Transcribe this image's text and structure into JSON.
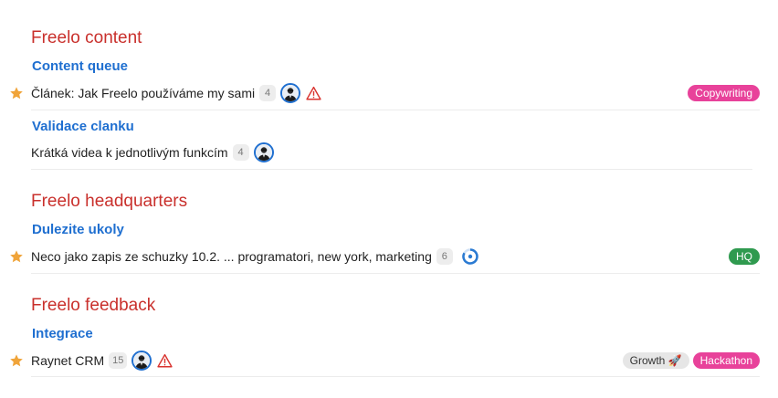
{
  "projects": [
    {
      "title": "Freelo content",
      "lists": [
        {
          "title": "Content queue",
          "tasks": [
            {
              "name": "Článek: Jak Freelo používáme my sami",
              "count": "4",
              "starred": true,
              "warning": true,
              "tags": [
                {
                  "label": "Copywriting",
                  "color": "#e8429a"
                }
              ]
            }
          ]
        },
        {
          "title": "Validace clanku",
          "tasks": [
            {
              "name": "Krátká videa k jednotlivým funkcím",
              "count": "4",
              "starred": false,
              "warning": false,
              "tags": []
            }
          ]
        }
      ]
    },
    {
      "title": "Freelo headquarters",
      "lists": [
        {
          "title": "Dulezite ukoly",
          "tasks": [
            {
              "name": "Neco jako zapis ze schuzky 10.2. ... programatori, new york, marketing",
              "count": "6",
              "starred": true,
              "warning": false,
              "tags": [
                {
                  "label": "HQ",
                  "color": "#2f9a4f"
                }
              ]
            }
          ]
        }
      ]
    },
    {
      "title": "Freelo feedback",
      "lists": [
        {
          "title": "Integrace",
          "tasks": [
            {
              "name": "Raynet CRM",
              "count": "15",
              "starred": true,
              "warning": true,
              "tags": [
                {
                  "label": "Growth 🚀",
                  "color": "#e6e6e6"
                },
                {
                  "label": "Hackathon",
                  "color": "#e8429a"
                }
              ]
            }
          ]
        }
      ]
    }
  ],
  "colors": {
    "project_title": "#c9302c",
    "list_title": "#1f6fd0",
    "star": "#f0a43a",
    "warning": "#d9332f"
  },
  "icons": {
    "star": "star-icon",
    "warning": "warning-icon",
    "avatar": "avatar",
    "progress": "progress-ring-icon"
  }
}
